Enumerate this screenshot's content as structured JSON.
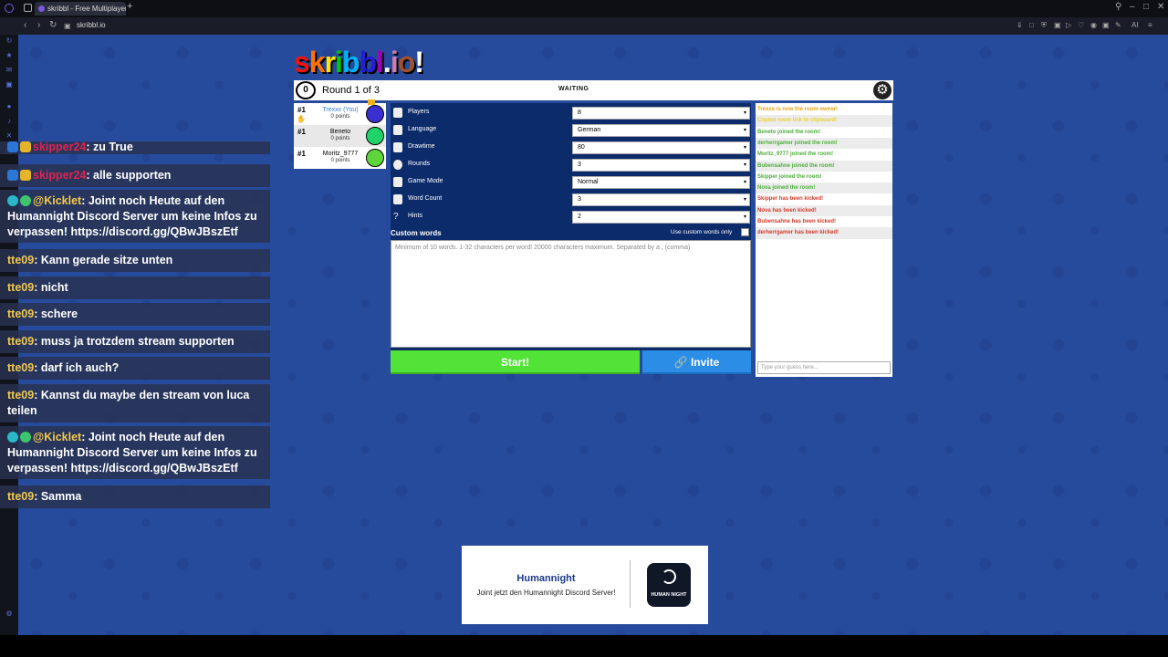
{
  "browser": {
    "tab_title": "skribbl - Free Multiplayer",
    "new_tab": "+",
    "url": "skribbl.io",
    "ext_label": "AI"
  },
  "chat": [
    {
      "user": "skipper24",
      "text": ": zu True",
      "red": true
    },
    {
      "user": "skipper24",
      "text": ": alle supporten",
      "red": true
    },
    {
      "user": "@Kicklet",
      "text": ": Joint noch Heute auf den Humannight Discord Server um keine Infos zu verpassen! https://discord.gg/QBwJBszEtf",
      "red": false
    },
    {
      "user": "tte09",
      "text": ": Kann gerade sitze unten",
      "red": false
    },
    {
      "user": "tte09",
      "text": ": nicht",
      "red": false
    },
    {
      "user": "tte09",
      "text": ": schere",
      "red": false
    },
    {
      "user": "tte09",
      "text": ": muss ja trotzdem stream supporten",
      "red": false
    },
    {
      "user": "tte09",
      "text": ": darf ich auch?",
      "red": false
    },
    {
      "user": "tte09",
      "text": ": Kannst du maybe den stream von luca teilen",
      "red": false
    },
    {
      "user": "@Kicklet",
      "text": ": Joint noch Heute auf den Humannight Discord Server um keine Infos zu verpassen! https://discord.gg/QBwJBszEtf",
      "red": false
    },
    {
      "user": "tte09",
      "text": ": Samma",
      "red": false
    }
  ],
  "game": {
    "logo_letters": [
      "s",
      "k",
      "r",
      "i",
      "b",
      "b",
      "l",
      ".",
      "i",
      "o",
      "!"
    ],
    "logo_colors": [
      "#ef130b",
      "#ff7100",
      "#ffe400",
      "#00cc00",
      "#00b2ff",
      "#231fd3",
      "#a300ba",
      ".",
      "#d37caa",
      "#a0522d",
      "#ffffff"
    ],
    "timer": "0",
    "round": "Round 1 of 3",
    "status": "WAITING",
    "players": [
      {
        "rank": "#1",
        "name": "Trexxx (You)",
        "points": "0 points",
        "you": true,
        "color": "#3a2fd0"
      },
      {
        "rank": "#1",
        "name": "Beneto",
        "points": "0 points",
        "you": false,
        "color": "#1fd36a"
      },
      {
        "rank": "#1",
        "name": "Moritz_9777",
        "points": "0 points",
        "you": false,
        "color": "#5ed53a"
      }
    ],
    "settings": [
      {
        "label": "Players",
        "value": "8"
      },
      {
        "label": "Language",
        "value": "German"
      },
      {
        "label": "Drawtime",
        "value": "80"
      },
      {
        "label": "Rounds",
        "value": "3"
      },
      {
        "label": "Game Mode",
        "value": "Normal"
      },
      {
        "label": "Word Count",
        "value": "3"
      },
      {
        "label": "Hints",
        "value": "2"
      }
    ],
    "custom_words_title": "Custom words",
    "custom_words_only": "Use custom words only",
    "custom_words_placeholder": "Minimum of 10 words. 1-32 characters per word! 20000 characters maximum. Separated by a , (comma)",
    "start_label": "Start!",
    "invite_label": "Invite",
    "log": [
      {
        "text": "Trexxx is now the room owner!",
        "color": "#e8a317"
      },
      {
        "text": "Copied room link to clipboard!",
        "color": "#e8d13a"
      },
      {
        "text": "Beneto joined the room!",
        "color": "#4caf3a"
      },
      {
        "text": "derherrgamer joined the room!",
        "color": "#4caf3a"
      },
      {
        "text": "Moritz_9777 joined the room!",
        "color": "#4caf3a"
      },
      {
        "text": "Bubensahne joined the room!",
        "color": "#4caf3a"
      },
      {
        "text": "Skipper joined the room!",
        "color": "#4caf3a"
      },
      {
        "text": "Nova joined the room!",
        "color": "#4caf3a"
      },
      {
        "text": "Skipper has been kicked!",
        "color": "#d63a2a"
      },
      {
        "text": "Nova has been kicked!",
        "color": "#d63a2a"
      },
      {
        "text": "Bubensahne has been kicked!",
        "color": "#d63a2a"
      },
      {
        "text": "derherrgamer has been kicked!",
        "color": "#d63a2a"
      }
    ],
    "guess_placeholder": "Type your guess here..."
  },
  "ad": {
    "title": "Humannight",
    "subtitle": "Joint jetzt den Humannight Discord Server!",
    "logo_text": "HUMAN NIGHT"
  }
}
